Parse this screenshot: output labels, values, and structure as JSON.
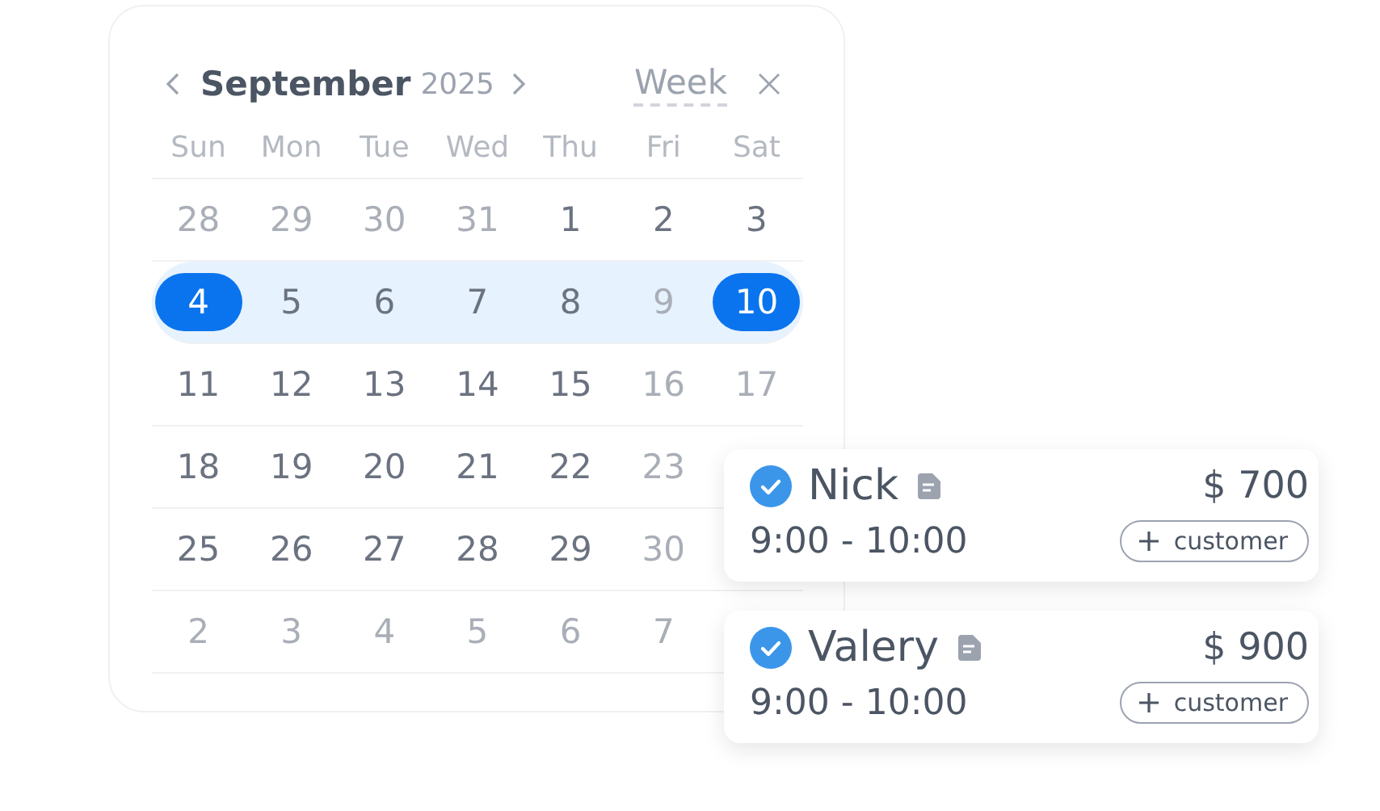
{
  "calendar": {
    "month": "September",
    "year": "2025",
    "view": "Week",
    "weekdays": [
      "Sun",
      "Mon",
      "Tue",
      "Wed",
      "Thu",
      "Fri",
      "Sat"
    ],
    "weeks": [
      {
        "in_range": false,
        "days": [
          {
            "label": "28",
            "muted": true,
            "selected": false
          },
          {
            "label": "29",
            "muted": true,
            "selected": false
          },
          {
            "label": "30",
            "muted": true,
            "selected": false
          },
          {
            "label": "31",
            "muted": true,
            "selected": false
          },
          {
            "label": "1",
            "muted": false,
            "selected": false
          },
          {
            "label": "2",
            "muted": false,
            "selected": false
          },
          {
            "label": "3",
            "muted": false,
            "selected": false
          }
        ]
      },
      {
        "in_range": true,
        "days": [
          {
            "label": "4",
            "muted": false,
            "selected": true
          },
          {
            "label": "5",
            "muted": false,
            "selected": false
          },
          {
            "label": "6",
            "muted": false,
            "selected": false
          },
          {
            "label": "7",
            "muted": false,
            "selected": false
          },
          {
            "label": "8",
            "muted": false,
            "selected": false
          },
          {
            "label": "9",
            "muted": true,
            "selected": false
          },
          {
            "label": "10",
            "muted": false,
            "selected": true
          }
        ]
      },
      {
        "in_range": false,
        "days": [
          {
            "label": "11",
            "muted": false,
            "selected": false
          },
          {
            "label": "12",
            "muted": false,
            "selected": false
          },
          {
            "label": "13",
            "muted": false,
            "selected": false
          },
          {
            "label": "14",
            "muted": false,
            "selected": false
          },
          {
            "label": "15",
            "muted": false,
            "selected": false
          },
          {
            "label": "16",
            "muted": true,
            "selected": false
          },
          {
            "label": "17",
            "muted": true,
            "selected": false
          }
        ]
      },
      {
        "in_range": false,
        "days": [
          {
            "label": "18",
            "muted": false,
            "selected": false
          },
          {
            "label": "19",
            "muted": false,
            "selected": false
          },
          {
            "label": "20",
            "muted": false,
            "selected": false
          },
          {
            "label": "21",
            "muted": false,
            "selected": false
          },
          {
            "label": "22",
            "muted": false,
            "selected": false
          },
          {
            "label": "23",
            "muted": true,
            "selected": false
          }
        ]
      },
      {
        "in_range": false,
        "days": [
          {
            "label": "25",
            "muted": false,
            "selected": false
          },
          {
            "label": "26",
            "muted": false,
            "selected": false
          },
          {
            "label": "27",
            "muted": false,
            "selected": false
          },
          {
            "label": "28",
            "muted": false,
            "selected": false
          },
          {
            "label": "29",
            "muted": false,
            "selected": false
          },
          {
            "label": "30",
            "muted": true,
            "selected": false
          }
        ]
      },
      {
        "in_range": false,
        "days": [
          {
            "label": "2",
            "muted": true,
            "selected": false
          },
          {
            "label": "3",
            "muted": true,
            "selected": false
          },
          {
            "label": "4",
            "muted": true,
            "selected": false
          },
          {
            "label": "5",
            "muted": true,
            "selected": false
          },
          {
            "label": "6",
            "muted": true,
            "selected": false
          },
          {
            "label": "7",
            "muted": true,
            "selected": false
          }
        ]
      }
    ]
  },
  "appointments": [
    {
      "name": "Nick",
      "checked": true,
      "price": "$ 700",
      "time": "9:00 - 10:00",
      "action": "customer"
    },
    {
      "name": "Valery",
      "checked": true,
      "price": "$ 900",
      "time": "9:00 - 10:00",
      "action": "customer"
    }
  ]
}
